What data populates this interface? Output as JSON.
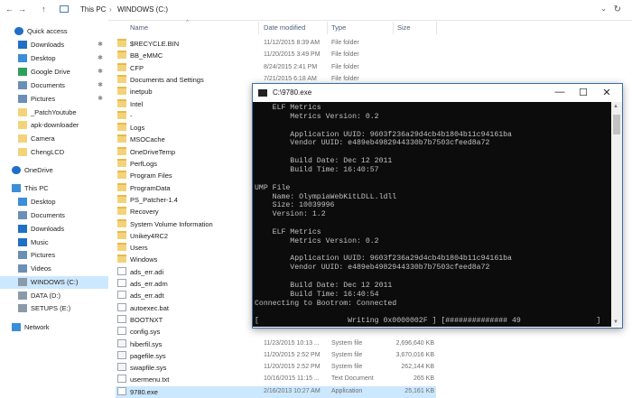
{
  "address_bar": {
    "back": "←",
    "forward": "→",
    "up": "↑",
    "crumbs": [
      "This PC",
      "›",
      "WINDOWS (C:)"
    ],
    "refresh": "↻",
    "chevron": "⌄"
  },
  "nav_pane": {
    "items": [
      {
        "label": "Quick access",
        "icon": "star-icon",
        "pinned": false
      },
      {
        "label": "Downloads",
        "icon": "download-icon",
        "pinned": true
      },
      {
        "label": "Desktop",
        "icon": "desktop-icon",
        "pinned": true
      },
      {
        "label": "Google Drive",
        "icon": "google-drive-icon",
        "pinned": true
      },
      {
        "label": "Documents",
        "icon": "documents-icon",
        "pinned": true
      },
      {
        "label": "Pictures",
        "icon": "pictures-icon",
        "pinned": true
      },
      {
        "label": "_PatchYoutube",
        "icon": "folder-icon",
        "pinned": false
      },
      {
        "label": "apk-downloader",
        "icon": "folder-icon",
        "pinned": false
      },
      {
        "label": "Camera",
        "icon": "folder-icon",
        "pinned": false
      },
      {
        "label": "ChengLCD",
        "icon": "folder-icon",
        "pinned": false
      },
      {
        "label": "OneDrive",
        "icon": "onedrive-icon",
        "pinned": false
      },
      {
        "label": "This PC",
        "icon": "pc-icon",
        "pinned": false
      },
      {
        "label": "Desktop",
        "icon": "desktop-icon",
        "pinned": false
      },
      {
        "label": "Documents",
        "icon": "documents-icon",
        "pinned": false
      },
      {
        "label": "Downloads",
        "icon": "download-icon",
        "pinned": false
      },
      {
        "label": "Music",
        "icon": "music-icon",
        "pinned": false
      },
      {
        "label": "Pictures",
        "icon": "pictures-icon",
        "pinned": false
      },
      {
        "label": "Videos",
        "icon": "videos-icon",
        "pinned": false
      },
      {
        "label": "WINDOWS (C:)",
        "icon": "drive-icon",
        "pinned": false,
        "selected": true
      },
      {
        "label": "DATA (D:)",
        "icon": "drive-icon",
        "pinned": false
      },
      {
        "label": "SETUPS (E:)",
        "icon": "drive-icon",
        "pinned": false
      },
      {
        "label": "Network",
        "icon": "network-icon",
        "pinned": false
      }
    ]
  },
  "file_list": {
    "columns": {
      "name": "Name",
      "date": "Date modified",
      "type": "Type",
      "size": "Size"
    },
    "rows": [
      {
        "name": "$RECYCLE.BIN",
        "date": "11/12/2015 8:39 AM",
        "type": "File folder",
        "size": "",
        "kind": "folder"
      },
      {
        "name": "BB_eMMC",
        "date": "11/20/2015 3:49 PM",
        "type": "File folder",
        "size": "",
        "kind": "folder"
      },
      {
        "name": "CFP",
        "date": "8/24/2015 2:41 PM",
        "type": "File folder",
        "size": "",
        "kind": "folder"
      },
      {
        "name": "Documents and Settings",
        "date": "7/21/2015 6:18 AM",
        "type": "File folder",
        "size": "",
        "kind": "folder"
      },
      {
        "name": "inetpub",
        "date": "",
        "type": "",
        "size": "",
        "kind": "folder"
      },
      {
        "name": "Intel",
        "date": "",
        "type": "",
        "size": "",
        "kind": "folder"
      },
      {
        "name": "-",
        "date": "",
        "type": "",
        "size": "",
        "kind": "folder"
      },
      {
        "name": "Logs",
        "date": "",
        "type": "",
        "size": "",
        "kind": "folder"
      },
      {
        "name": "MSOCache",
        "date": "",
        "type": "",
        "size": "",
        "kind": "folder"
      },
      {
        "name": "OneDriveTemp",
        "date": "",
        "type": "",
        "size": "",
        "kind": "folder"
      },
      {
        "name": "PerfLogs",
        "date": "",
        "type": "",
        "size": "",
        "kind": "folder"
      },
      {
        "name": "Program Files",
        "date": "",
        "type": "",
        "size": "",
        "kind": "folder"
      },
      {
        "name": "ProgramData",
        "date": "",
        "type": "",
        "size": "",
        "kind": "folder"
      },
      {
        "name": "PS_Patcher-1.4",
        "date": "",
        "type": "",
        "size": "",
        "kind": "folder"
      },
      {
        "name": "Recovery",
        "date": "",
        "type": "",
        "size": "",
        "kind": "folder"
      },
      {
        "name": "System Volume Information",
        "date": "",
        "type": "",
        "size": "",
        "kind": "folder"
      },
      {
        "name": "Unikey4RC2",
        "date": "",
        "type": "",
        "size": "",
        "kind": "folder"
      },
      {
        "name": "Users",
        "date": "",
        "type": "",
        "size": "",
        "kind": "folder"
      },
      {
        "name": "Windows",
        "date": "",
        "type": "",
        "size": "",
        "kind": "folder"
      },
      {
        "name": "ads_err.adi",
        "date": "",
        "type": "",
        "size": "",
        "kind": "file"
      },
      {
        "name": "ads_err.adm",
        "date": "",
        "type": "",
        "size": "",
        "kind": "file"
      },
      {
        "name": "ads_err.adt",
        "date": "",
        "type": "",
        "size": "",
        "kind": "file"
      },
      {
        "name": "autoexec.bat",
        "date": "",
        "type": "",
        "size": "",
        "kind": "file"
      },
      {
        "name": "BOOTNXT",
        "date": "",
        "type": "",
        "size": "",
        "kind": "file"
      },
      {
        "name": "config.sys",
        "date": "",
        "type": "",
        "size": "",
        "kind": "file"
      },
      {
        "name": "hiberfil.sys",
        "date": "11/23/2015 10:13 ...",
        "type": "System file",
        "size": "2,696,640 KB",
        "kind": "sys"
      },
      {
        "name": "pagefile.sys",
        "date": "11/20/2015 2:52 PM",
        "type": "System file",
        "size": "3,670,016 KB",
        "kind": "sys"
      },
      {
        "name": "swapfile.sys",
        "date": "11/20/2015 2:52 PM",
        "type": "System file",
        "size": "262,144 KB",
        "kind": "sys"
      },
      {
        "name": "usermenu.txt",
        "date": "10/16/2015 11:15 ...",
        "type": "Text Document",
        "size": "265 KB",
        "kind": "file"
      },
      {
        "name": "9780.exe",
        "date": "2/16/2013 10:27 AM",
        "type": "Application",
        "size": "25,161 KB",
        "kind": "exe",
        "selected": true
      }
    ]
  },
  "console": {
    "title": "C:\\9780.exe",
    "window_buttons": {
      "minimize": "—",
      "maximize": "☐",
      "close": "✕"
    },
    "lines": [
      "    ELF Metrics",
      "        Metrics Version: 0.2",
      "",
      "        Application UUID: 9603f236a29d4cb4b1804b11c94161ba",
      "        Vendor UUID: e489eb4982944330b7b7503cfeed8a72",
      "",
      "        Build Date: Dec 12 2011",
      "        Build Time: 16:40:57",
      "",
      "UMP File",
      "    Name: OlympiaWebKitLDLL.ldll",
      "    Size: 10039996",
      "    Version: 1.2",
      "",
      "    ELF Metrics",
      "        Metrics Version: 0.2",
      "",
      "        Application UUID: 9603f236a29d4cb4b1804b11c94161ba",
      "        Vendor UUID: e489eb4982944330b7b7503cfeed8a72",
      "",
      "        Build Date: Dec 12 2011",
      "        Build Time: 16:40:54",
      "Connecting to Bootrom: Connected",
      "",
      "[                    Writing 0x0000002F ] [############## 49                 ]"
    ]
  },
  "colors": {
    "accent": "#0078d7",
    "selection": "#cce8ff",
    "folder": "#f3d37a",
    "console_bg": "#0c0c0c",
    "console_text": "#c0c0c0"
  }
}
